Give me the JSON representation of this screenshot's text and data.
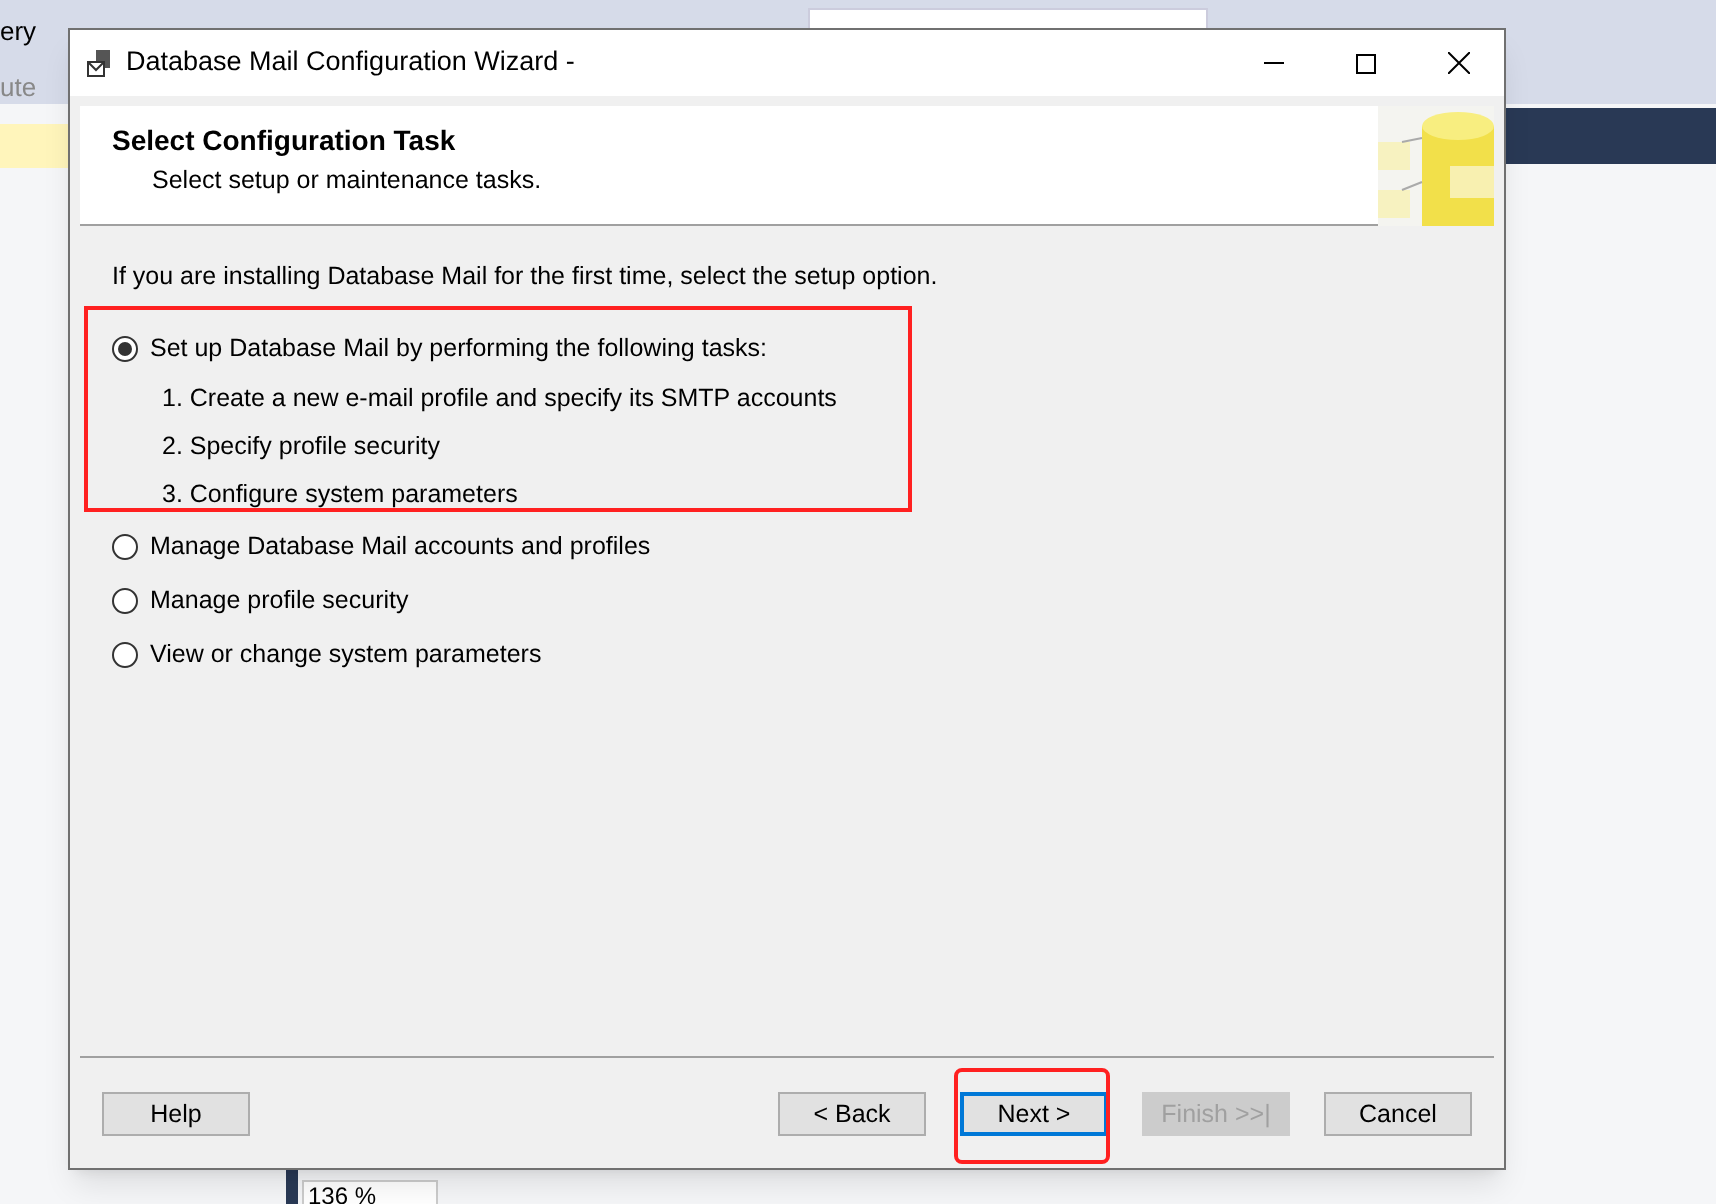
{
  "background": {
    "menu_item": "ery",
    "toolbar_label": "ute",
    "zoom_value": "136 %"
  },
  "window": {
    "title": "Database Mail Configuration Wizard -"
  },
  "header": {
    "title": "Select Configuration Task",
    "subtitle": "Select setup or maintenance tasks."
  },
  "intro": "If you are installing Database Mail for the first time, select the setup option.",
  "options": [
    {
      "label": "Set up Database Mail by performing the following tasks:",
      "selected": true,
      "highlighted": true,
      "steps": [
        "1. Create a new e-mail profile and specify its SMTP accounts",
        "2. Specify profile security",
        "3. Configure system parameters"
      ]
    },
    {
      "label": "Manage Database Mail accounts and profiles",
      "selected": false,
      "highlighted": false
    },
    {
      "label": "Manage profile security",
      "selected": false,
      "highlighted": false
    },
    {
      "label": "View or change system parameters",
      "selected": false,
      "highlighted": false
    }
  ],
  "buttons": [
    {
      "label": "Help",
      "disabled": false,
      "default": false,
      "highlighted": false
    },
    {
      "label": "< Back",
      "disabled": false,
      "default": false,
      "highlighted": false
    },
    {
      "label": "Next >",
      "disabled": false,
      "default": true,
      "highlighted": true
    },
    {
      "label": "Finish >>|",
      "disabled": true,
      "default": false,
      "highlighted": false
    },
    {
      "label": "Cancel",
      "disabled": false,
      "default": false,
      "highlighted": false
    }
  ]
}
